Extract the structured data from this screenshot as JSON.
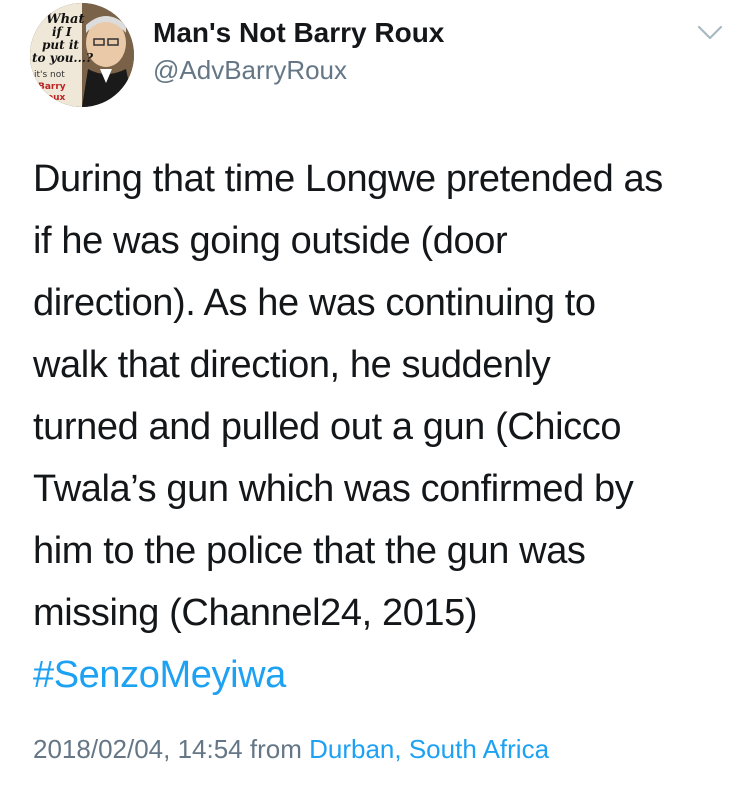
{
  "author": {
    "display_name": "Man's Not Barry Roux",
    "handle": "@AdvBarryRoux",
    "avatar_text": [
      "What",
      "if I",
      "put it",
      "to you...?",
      "it's not",
      "Barry",
      "Roux"
    ]
  },
  "tweet": {
    "lines": [
      "During that time Longwe pretended as",
      "if he was going outside (door",
      "direction). As he was continuing to",
      "walk that direction, he suddenly",
      "turned and pulled out a gun (Chicco",
      "Twala’s gun which was confirmed by",
      "him to the police that the gun was",
      "missing (Channel24, 2015)"
    ],
    "hashtag": "#SenzoMeyiwa",
    "timestamp": "2018/02/04, 14:54",
    "from_label": "from",
    "location": "Durban, South Africa"
  },
  "icons": {
    "menu": "chevron-down-icon"
  },
  "colors": {
    "link": "#1da1f2",
    "secondary": "#657786",
    "text": "#14171a"
  }
}
